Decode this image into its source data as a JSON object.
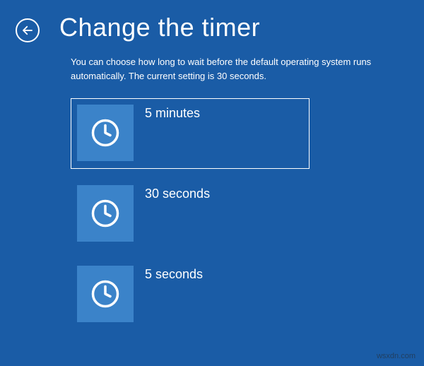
{
  "header": {
    "title": "Change the timer"
  },
  "description": "You can choose how long to wait before the default operating system runs automatically. The current setting is 30 seconds.",
  "options": [
    {
      "label": "5 minutes",
      "selected": true
    },
    {
      "label": "30 seconds",
      "selected": false
    },
    {
      "label": "5 seconds",
      "selected": false
    }
  ],
  "watermark": "wsxdn.com"
}
